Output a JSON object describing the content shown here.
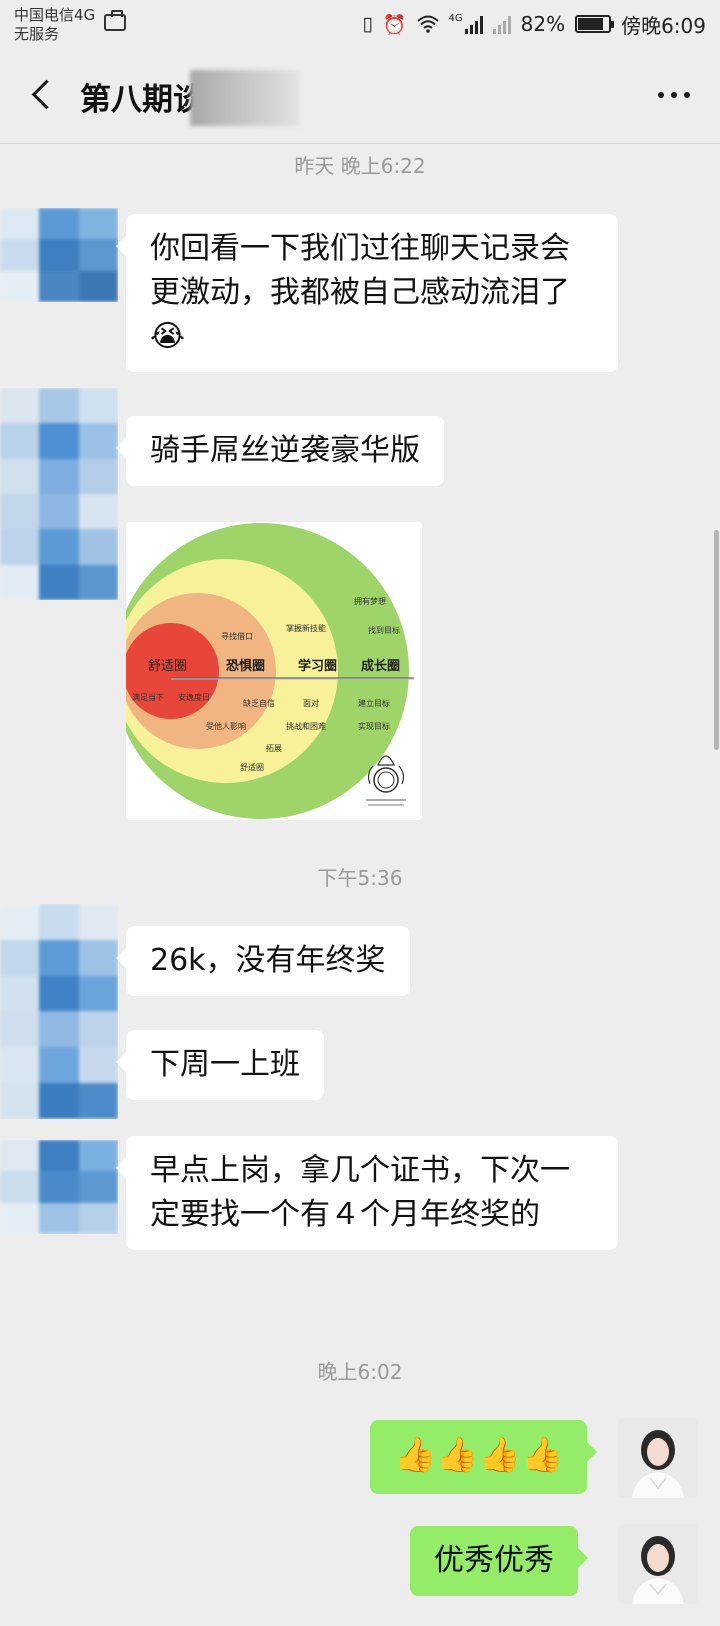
{
  "status_bar": {
    "carrier": "中国电信4G",
    "service": "无服务",
    "network": "4G",
    "battery": "82%",
    "battery_level": 0.82,
    "time": "傍晚6:09"
  },
  "header": {
    "title": "第八期谈"
  },
  "messages": {
    "ts1": "昨天 晚上6:22",
    "m1": "你回看一下我们过往聊天记录会更激动，我都被自己感动流泪了😭",
    "m2": "骑手屌丝逆袭豪华版",
    "image": {
      "zones": [
        "舒适圈",
        "恐惧圈",
        "学习圈",
        "成长圈"
      ],
      "fear_notes": [
        "寻找借口",
        "满足当下",
        "缺乏自信",
        "受他人影响"
      ],
      "comfort_note": "安逸度日",
      "learning_notes": [
        "掌握新技能",
        "面对",
        "挑战和困难",
        "拓展",
        "舒适圈"
      ],
      "growth_notes": [
        "拥有梦想",
        "找到目标",
        "建立目标",
        "实现目标"
      ]
    },
    "ts2": "下午5:36",
    "m3": "26k，没有年终奖",
    "m4": "下周一上班",
    "m5": "早点上岗，拿几个证书，下次一定要找一个有４个月年终奖的",
    "ts3": "晚上6:02",
    "m6": "👍👍👍👍",
    "m7": "优秀优秀"
  },
  "colors": {
    "background": "#ededed",
    "bubble_left": "#ffffff",
    "bubble_right": "#95ec69"
  }
}
